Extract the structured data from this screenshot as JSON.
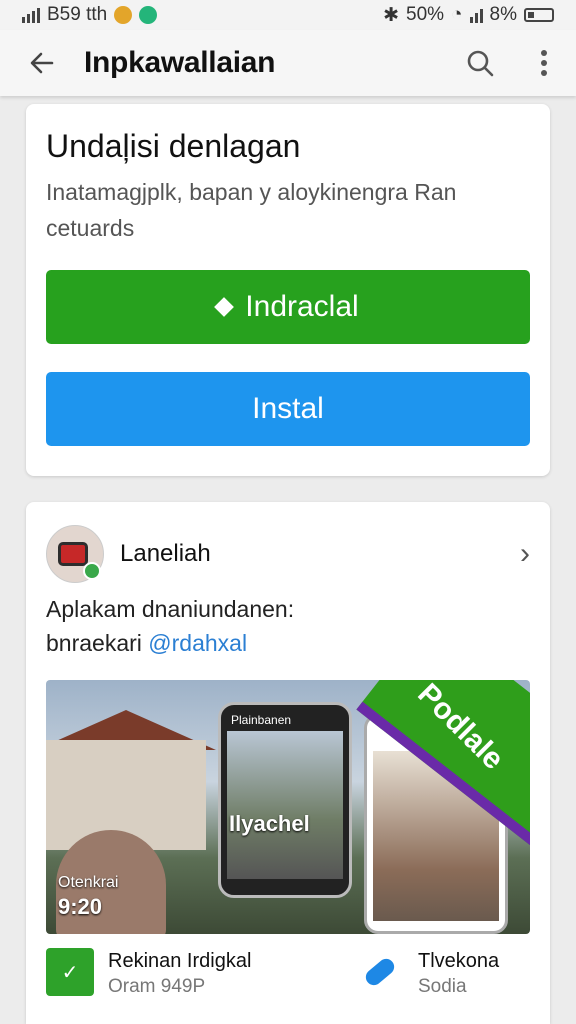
{
  "status_bar": {
    "time": "B59 tth",
    "battery_text": "50%",
    "battery2_text": "8%"
  },
  "app_bar": {
    "title": "Inpkawallaian"
  },
  "install_card": {
    "title": "Undaļisi denlagan",
    "description": "Inatamagjplk, bapan y aloykinengra Ran cetuards",
    "primary_button": "Indraclal",
    "secondary_button": "Instal"
  },
  "developer_card": {
    "name": "Laneliah",
    "description_line1": "Aplakam dnaniundanen:",
    "description_prefix": "bnraekari",
    "handle": "@rdahxal",
    "promo": {
      "phone_header": "Plainbanen",
      "phone_label": "Ilyachel",
      "ribbon_text": "Podlale",
      "overlay_label": "Otenkrai",
      "overlay_time": "9:20"
    },
    "related_apps": [
      {
        "name": "Rekinan Irdigkal",
        "sub": "Oram 949P",
        "icon": "check-icon",
        "color": "#2ea22a"
      },
      {
        "name": "Tlvekona",
        "sub": "Sodia",
        "icon": "pill-icon",
        "color": "#1e88e5"
      }
    ]
  },
  "colors": {
    "green": "#27a11e",
    "blue": "#1e95ee",
    "handle": "#2b7fd3"
  }
}
